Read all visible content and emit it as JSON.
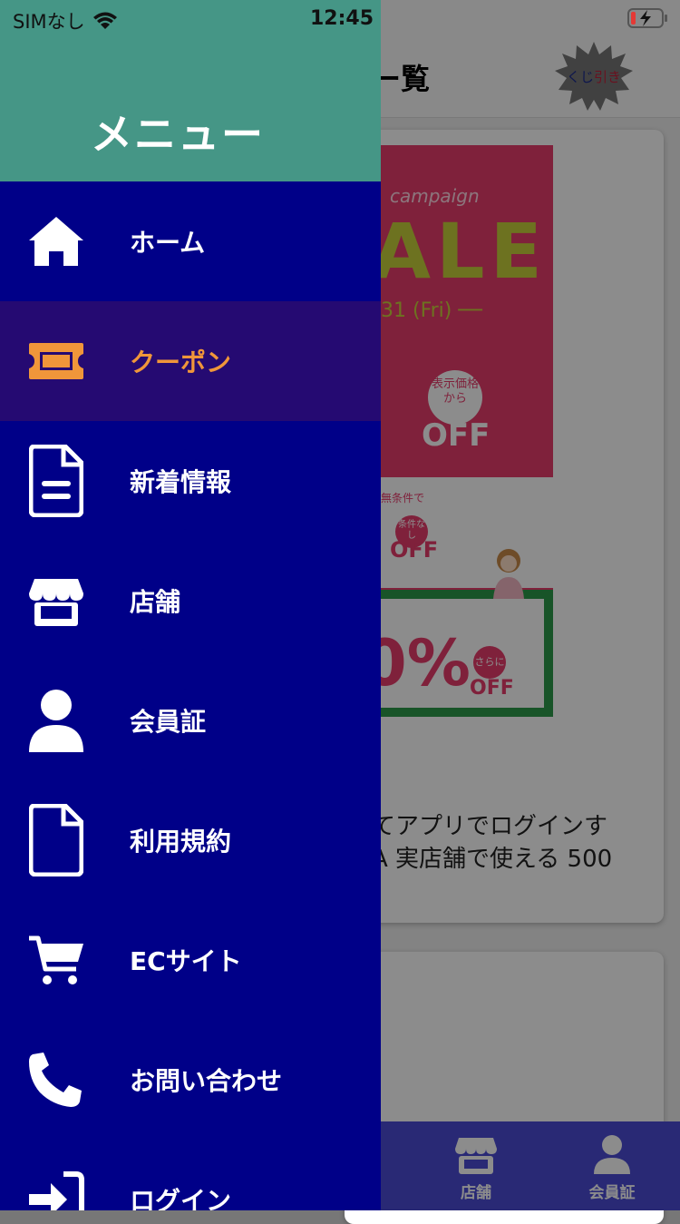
{
  "status_bar": {
    "carrier": "SIMなし",
    "time": "12:45"
  },
  "background": {
    "page_title": "ー覧",
    "kuji_button": {
      "prefix": "くじ",
      "suffix": "引き"
    },
    "banner": {
      "campaign": "campaign",
      "sale": "ALE",
      "date": "31 (Fri) ──",
      "badge1": "表示価格から",
      "off1": "OFF",
      "mujoken": "無条件で",
      "badge2": "条件なし",
      "off2": "OFF",
      "big_pct": "0%",
      "badge3": "さらに",
      "off3": "OFF"
    },
    "card_text_line1": "てアプリでログインす",
    "card_text_line2": "A 実店舗で使える 500",
    "tabs": [
      {
        "label": "店舗",
        "icon": "store-icon"
      },
      {
        "label": "会員証",
        "icon": "user-icon"
      }
    ]
  },
  "drawer": {
    "title": "メニュー",
    "items": [
      {
        "label": "ホーム",
        "icon": "home-icon",
        "active": false
      },
      {
        "label": "クーポン",
        "icon": "ticket-icon",
        "active": true
      },
      {
        "label": "新着情報",
        "icon": "document-icon",
        "active": false
      },
      {
        "label": "店舗",
        "icon": "store-icon",
        "active": false
      },
      {
        "label": "会員証",
        "icon": "user-icon",
        "active": false
      },
      {
        "label": "利用規約",
        "icon": "file-icon",
        "active": false
      },
      {
        "label": "ECサイト",
        "icon": "cart-icon",
        "active": false
      },
      {
        "label": "お問い合わせ",
        "icon": "phone-icon",
        "active": false
      },
      {
        "label": "ログイン",
        "icon": "login-icon",
        "active": false
      }
    ]
  },
  "colors": {
    "drawer_bg": "#000088",
    "drawer_header": "#459686",
    "active_bg": "#250a72",
    "active_text": "#f0963a",
    "tabbar": "#4b4bd6"
  }
}
